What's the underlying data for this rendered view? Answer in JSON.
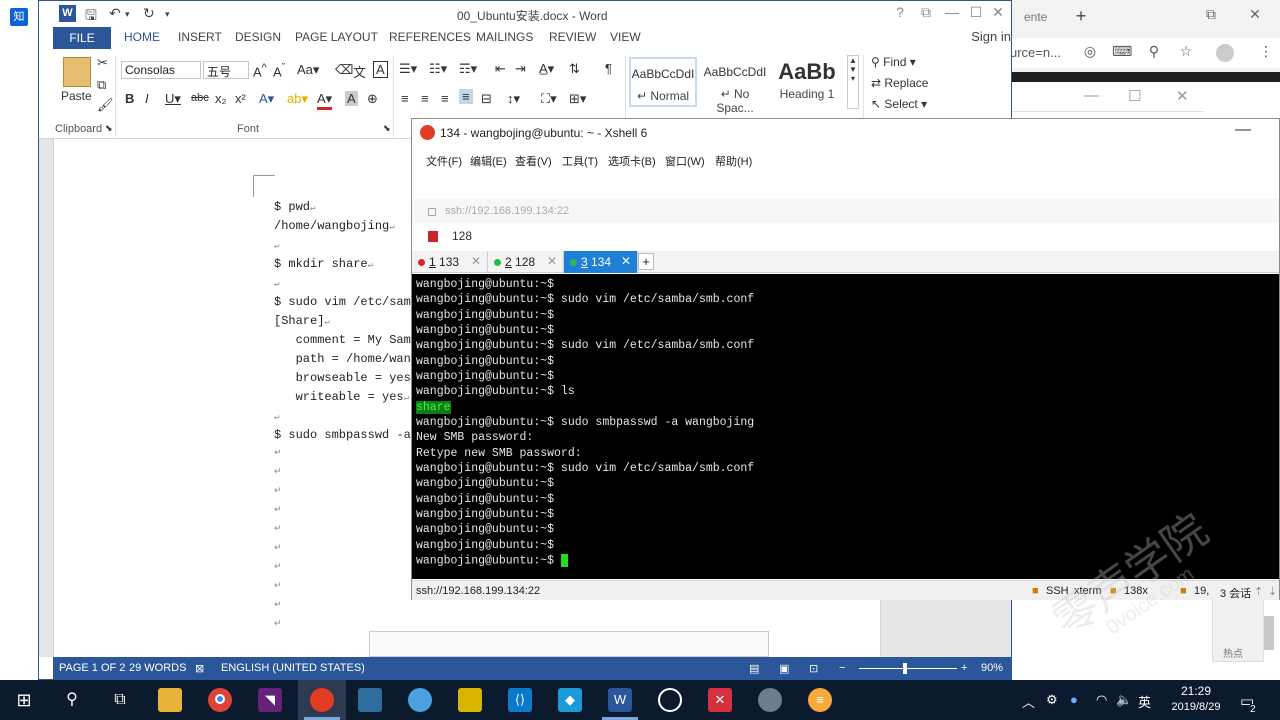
{
  "browser": {
    "tab_label": "ente",
    "new_tab": "+",
    "address_partial": "urce=n...",
    "dark_dialog_buttons": [
      "—",
      "☐",
      "✕"
    ]
  },
  "word": {
    "title": "00_Ubuntu安装.docx - Word",
    "title_buttons": [
      "?",
      "⧉",
      "—",
      "☐",
      "✕"
    ],
    "tabs": [
      "FILE",
      "HOME",
      "INSERT",
      "DESIGN",
      "PAGE LAYOUT",
      "REFERENCES",
      "MAILINGS",
      "REVIEW",
      "VIEW"
    ],
    "sign_in": "Sign in",
    "clipboard_label": "Clipboard",
    "paste_label": "Paste",
    "font_label": "Font",
    "font_name": "Consolas",
    "font_size": "五号",
    "styles": [
      {
        "sample": "AaBbCcDdI",
        "name": "↵ Normal"
      },
      {
        "sample": "AaBbCcDdI",
        "name": "↵ No Spac..."
      },
      {
        "sample": "AaBb",
        "name": "Heading 1"
      }
    ],
    "editing": {
      "find": "Find",
      "replace": "Replace",
      "select": "Select"
    },
    "doc_lines": [
      "$ pwd",
      "/home/wangbojing",
      "",
      "$ mkdir share",
      "",
      "$ sudo vim /etc/samba",
      "[Share]",
      "   comment = My Samb",
      "   path = /home/wang",
      "   browseable = yes",
      "   writeable = yes",
      "",
      "$ sudo smbpasswd -a"
    ],
    "status": {
      "page": "PAGE 1 OF 2",
      "words": "29 WORDS",
      "language": "ENGLISH (UNITED STATES)",
      "zoom": "90%"
    }
  },
  "xshell": {
    "title": "134 - wangbojing@ubuntu: ~ - Xshell 6",
    "menu": [
      "文件(F)",
      "编辑(E)",
      "查看(V)",
      "工具(T)",
      "选项卡(B)",
      "窗口(W)",
      "帮助(H)"
    ],
    "address": "ssh://192.168.199.134:22",
    "link_label": "128",
    "tabs": [
      {
        "num": "1",
        "label": "133",
        "dot": "#e0212a",
        "active": false
      },
      {
        "num": "2",
        "label": "128",
        "dot": "#2db84a",
        "active": false
      },
      {
        "num": "3",
        "label": "134",
        "dot": "#2db84a",
        "active": true
      }
    ],
    "terminal_lines": [
      "wangbojing@ubuntu:~$",
      "wangbojing@ubuntu:~$ sudo vim /etc/samba/smb.conf",
      "wangbojing@ubuntu:~$",
      "wangbojing@ubuntu:~$",
      "wangbojing@ubuntu:~$ sudo vim /etc/samba/smb.conf",
      "wangbojing@ubuntu:~$",
      "wangbojing@ubuntu:~$",
      "wangbojing@ubuntu:~$ ls",
      "share",
      "wangbojing@ubuntu:~$ sudo smbpasswd -a wangbojing",
      "New SMB password:",
      "Retype new SMB password:",
      "wangbojing@ubuntu:~$ sudo vim /etc/samba/smb.conf",
      "wangbojing@ubuntu:~$",
      "wangbojing@ubuntu:~$",
      "wangbojing@ubuntu:~$",
      "wangbojing@ubuntu:~$",
      "wangbojing@ubuntu:~$",
      "wangbojing@ubuntu:~$"
    ],
    "status": {
      "address": "ssh://192.168.199.134:22",
      "ssh": "SSH",
      "term": "xterm",
      "size": "138x",
      "pos": "19,",
      "sessions": "3 会话"
    }
  },
  "taskbar": {
    "time": "21:29",
    "date": "2019/8/29",
    "ime": "英",
    "notification_count": "2"
  }
}
